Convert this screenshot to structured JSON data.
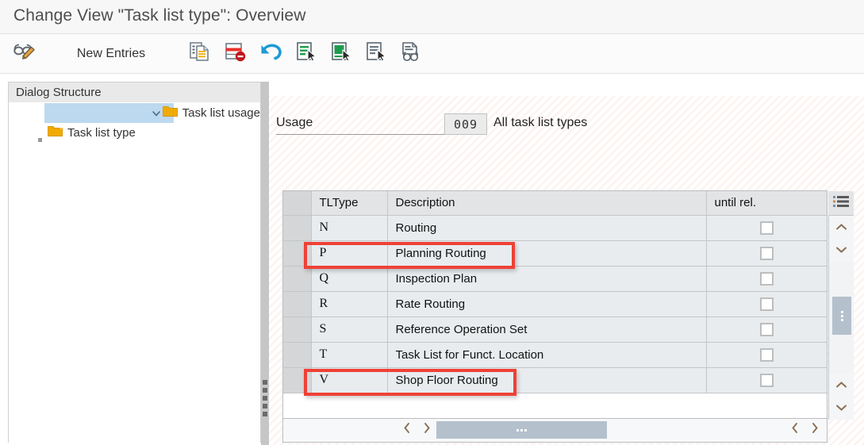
{
  "window": {
    "title": "Change View \"Task list type\": Overview"
  },
  "toolbar": {
    "display_change_icon": "glasses-pencil-icon",
    "new_entries_label": "New Entries",
    "items": [
      {
        "name": "copy-as-button",
        "icon": "copy-document-icon"
      },
      {
        "name": "delete-button",
        "icon": "delete-row-icon"
      },
      {
        "name": "undo-button",
        "icon": "undo-arrow-icon"
      },
      {
        "name": "select-all-button",
        "icon": "document-select-green-lines-icon"
      },
      {
        "name": "select-block-button",
        "icon": "document-select-green-block-icon"
      },
      {
        "name": "deselect-all-button",
        "icon": "document-select-gray-icon"
      },
      {
        "name": "search-button",
        "icon": "document-glasses-icon"
      }
    ]
  },
  "sidebar": {
    "header": "Dialog Structure",
    "nodes": [
      {
        "label": "Task list usage",
        "level": 1,
        "expanded": true,
        "selected": "blue"
      },
      {
        "label": "Task list type",
        "level": 2,
        "expanded": false,
        "selected": "yellow"
      }
    ]
  },
  "form": {
    "usage_label": "Usage",
    "usage_value": "009",
    "usage_description": "All task list types"
  },
  "table": {
    "columns": [
      "",
      "TLType",
      "Description",
      "until rel."
    ],
    "rows": [
      {
        "type": "N",
        "description": "Routing",
        "until_rel": false,
        "highlighted": false
      },
      {
        "type": "P",
        "description": "Planning Routing",
        "until_rel": false,
        "highlighted": true
      },
      {
        "type": "Q",
        "description": "Inspection Plan",
        "until_rel": false,
        "highlighted": false
      },
      {
        "type": "R",
        "description": "Rate Routing",
        "until_rel": false,
        "highlighted": false
      },
      {
        "type": "S",
        "description": "Reference Operation Set",
        "until_rel": false,
        "highlighted": false
      },
      {
        "type": "T",
        "description": "Task List for Funct. Location",
        "until_rel": false,
        "highlighted": false
      },
      {
        "type": "V",
        "description": "Shop Floor Routing",
        "until_rel": false,
        "highlighted": true
      }
    ]
  },
  "scrollbars": {
    "settings_icon": "table-settings-icon",
    "vertical_up_icon": "chevron-up-icon",
    "vertical_down_icon": "chevron-down-icon",
    "horizontal_left_icon": "chevron-left-icon",
    "horizontal_right_icon": "chevron-right-icon"
  },
  "colors": {
    "annotation": "#ef4136",
    "selection_blue": "#bdd9ef",
    "selection_yellow": "#fdf8ca",
    "folder": "#f0ab00",
    "row_background": "#e8ecef",
    "header_background": "#e3e4e6"
  }
}
